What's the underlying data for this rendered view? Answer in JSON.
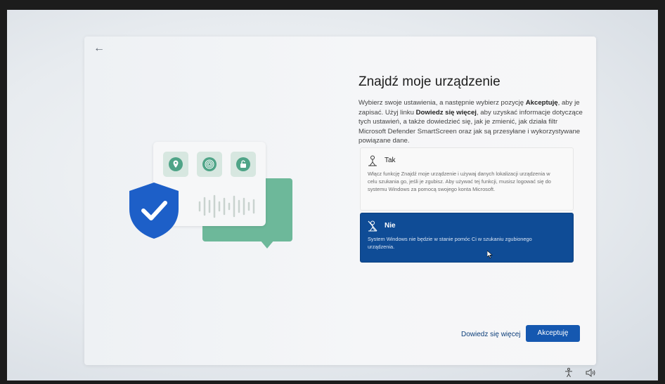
{
  "window": {
    "back_icon": "back-arrow-icon",
    "back_glyph": "←"
  },
  "page": {
    "title": "Znajdź moje urządzenie",
    "desc": {
      "p1": "Wybierz swoje ustawienia, a następnie wybierz pozycję ",
      "bold1": "Akceptuję",
      "p2": ", aby je zapisać. Użyj linku ",
      "bold2": "Dowiedz się więcej",
      "p3": ", aby uzyskać informacje dotyczące tych ustawień, a także dowiedzieć się, jak je zmienić, jak działa filtr Microsoft Defender SmartScreen oraz jak są przesyłane i wykorzystywane powiązane dane."
    }
  },
  "options": [
    {
      "title": "Tak",
      "icon": "location-person-icon",
      "description": "Włącz funkcję Znajdź moje urządzenie i używaj danych lokalizacji urządzenia w celu szukania go, jeśli je zgubisz. Aby używać tej funkcji, musisz logować się do systemu Windows za pomocą swojego konta Microsoft.",
      "selected": false
    },
    {
      "title": "Nie",
      "icon": "location-off-icon",
      "description": "System Windows nie będzie w stanie pomóc Ci w szukaniu zgubionego urządzenia.",
      "selected": true
    }
  ],
  "buttons": {
    "learn_more": "Dowiedz się więcej",
    "accept": "Akceptuję"
  },
  "illustration": {
    "icons": [
      "location-pin-icon",
      "fingerprint-icon",
      "unlocked-padlock-icon",
      "shield-check-icon",
      "sound-wave-icon"
    ]
  },
  "tray": {
    "icons": [
      "accessibility-icon",
      "volume-icon"
    ]
  },
  "colors": {
    "accent": "#1558b0",
    "selected_option": "#0f4c96",
    "illustration_green": "#6db89a",
    "shield_blue": "#1d5fc8"
  }
}
